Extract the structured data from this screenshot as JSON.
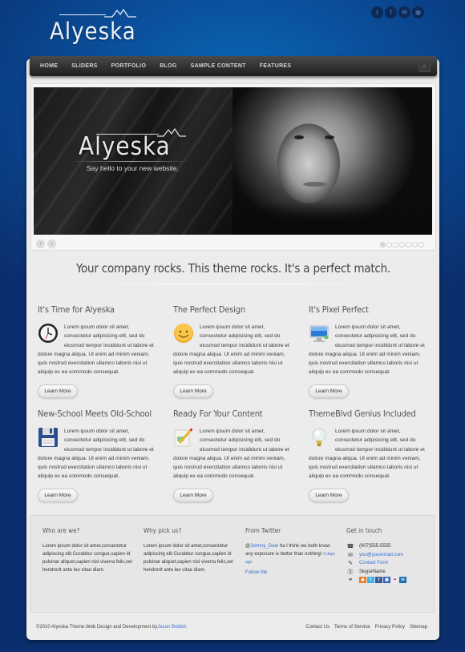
{
  "site": {
    "logo_text": "Alyeska",
    "social": [
      {
        "name": "twitter-icon",
        "glyph": "t"
      },
      {
        "name": "facebook-icon",
        "glyph": "f"
      },
      {
        "name": "email-icon",
        "glyph": "✉"
      },
      {
        "name": "rss-icon",
        "glyph": "◉"
      }
    ]
  },
  "nav": {
    "items": [
      "HOME",
      "SLIDERS",
      "PORTFOLIO",
      "BLOG",
      "SAMPLE CONTENT",
      "FEATURES"
    ],
    "search_icon": "⌕"
  },
  "slider": {
    "logo_text": "Alyeska",
    "tagline": "Say hello to your new website.",
    "prev": "‹",
    "next": "›",
    "total_slides": 7,
    "active_slide": 1
  },
  "tagline": "Your company rocks. This theme rocks. It's a perfect match.",
  "features": [
    {
      "title": "It's Time for Alyeska",
      "icon": "clock-icon",
      "text": "Lorem ipsum dolor sit amet, consectetur adipisicing elit, sed do eiusmod tempor incididunt ut labore et dolore magna aliqua. Ut enim ad minim veniam, quis nostrud exercitation ullamco laboris nisi ut aliquip ex ea commodo consequat.",
      "button": "Learn More"
    },
    {
      "title": "The Perfect Design",
      "icon": "smiley-icon",
      "text": "Lorem ipsum dolor sit amet, consectetur adipisicing elit, sed do eiusmod tempor incididunt ut labore et dolore magna aliqua. Ut enim ad minim veniam, quis nostrud exercitation ullamco laboris nisi ut aliquip ex ea commodo consequat.",
      "button": "Learn More"
    },
    {
      "title": "It's Pixel Perfect",
      "icon": "monitor-icon",
      "text": "Lorem ipsum dolor sit amet, consectetur adipisicing elit, sed do eiusmod tempor incididunt ut labore et dolore magna aliqua. Ut enim ad minim veniam, quis nostrud exercitation ullamco laboris nisi ut aliquip ex ea commodo consequat.",
      "button": "Learn More"
    },
    {
      "title": "New-School Meets Old-School",
      "icon": "floppy-disk-icon",
      "text": "Lorem ipsum dolor sit amet, consectetur adipisicing elit, sed do eiusmod tempor incididunt ut labore et dolore magna aliqua. Ut enim ad minim veniam, quis nostrud exercitation ullamco laboris nisi ut aliquip ex ea commodo consequat.",
      "button": "Learn More"
    },
    {
      "title": "Ready For Your Content",
      "icon": "pencil-document-icon",
      "text": "Lorem ipsum dolor sit amet, consectetur adipisicing elit, sed do eiusmod tempor incididunt ut labore et dolore magna aliqua. Ut enim ad minim veniam, quis nostrud exercitation ullamco laboris nisi ut aliquip ex ea commodo consequat.",
      "button": "Learn More"
    },
    {
      "title": "ThemeBlvd Genius Included",
      "icon": "lightbulb-icon",
      "text": "Lorem ipsum dolor sit amet, consectetur adipisicing elit, sed do eiusmod tempor incididunt ut labore et dolore magna aliqua. Ut enim ad minim veniam, quis nostrud exercitation ullamco laboris nisi ut aliquip ex ea commodo consequat.",
      "button": "Learn More"
    }
  ],
  "footer": {
    "who": {
      "title": "Who are we?",
      "text": "Lorem ipsum dolor sit amet,consectetur adipiscing elit.Curabitur congue,sapien id pulvinar aliquet,sapien nisl viverra felis,vel hendrerit ante leo vitae diam."
    },
    "why": {
      "title": "Why pick us?",
      "text": "Lorem ipsum dolor sit amet,consectetur adipiscing elit.Curabitur congue,sapien id pulvinar aliquet,sapien nisl viverra felis,vel hendrerit ante leo vitae diam."
    },
    "twitter": {
      "title": "From Twitter",
      "at": "@",
      "user": "Johnny_Dale",
      "text": " ha I think we both know any exposure is better than nothing!",
      "time": "3 days ago",
      "follow": "Follow Me"
    },
    "contact": {
      "title": "Get in touch",
      "phone": "(907)555-5555",
      "email": "you@youremail.com",
      "form": "Contact Form",
      "skype": "SkypeName",
      "networks": [
        {
          "name": "rss",
          "glyph": "◉",
          "color": "#f07a1e"
        },
        {
          "name": "twitter",
          "glyph": "t",
          "color": "#3fb2e6"
        },
        {
          "name": "facebook",
          "glyph": "f",
          "color": "#3b5b9a"
        },
        {
          "name": "delicious",
          "glyph": "▦",
          "color": "#3060c0"
        },
        {
          "name": "flickr",
          "glyph": "••",
          "color": "#e8e8ee"
        },
        {
          "name": "linkedin",
          "glyph": "in",
          "color": "#1c6fb0"
        }
      ]
    }
  },
  "copyright": {
    "text": "©2010 Alyeska Theme.Web Design and Development by",
    "author": "Jason Bobich",
    "end": "."
  },
  "bottom_links": [
    "Contact Us",
    "Terms of Service",
    "Privacy Policy",
    "Sitemap"
  ]
}
